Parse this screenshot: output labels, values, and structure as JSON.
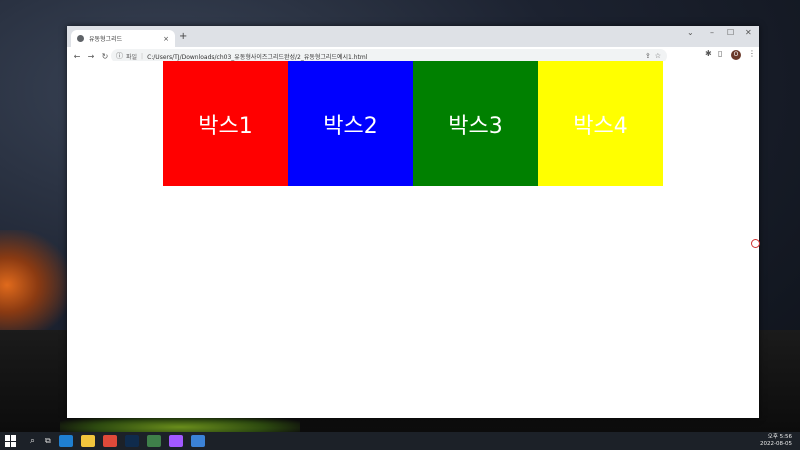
{
  "browser": {
    "tab_title": "유동형그리드",
    "tab_close": "×",
    "new_tab": "+",
    "window_controls": {
      "minimize": "–",
      "maximize": "☐",
      "close": "✕",
      "tab_search": "⌄"
    },
    "nav": {
      "back": "←",
      "forward": "→",
      "reload": "↻"
    },
    "address": {
      "info_icon": "ⓘ",
      "scheme_label": "파일",
      "separator": "|",
      "url": "C:/Users/TJ/Downloads/ch03_유동형사이즈그리드완성/2_유동형그리드예시1.html"
    },
    "omnibox_icons": {
      "share": "⇪",
      "star": "☆"
    },
    "toolbar_icons": {
      "extensions": "✱",
      "sidepanel": "▯",
      "menu": "⋮"
    },
    "profile_initial": "O"
  },
  "page": {
    "boxes": [
      {
        "label": "박스1",
        "color": "#ff0000"
      },
      {
        "label": "박스2",
        "color": "#0000ff"
      },
      {
        "label": "박스3",
        "color": "#008000"
      },
      {
        "label": "박스4",
        "color": "#ffff00"
      }
    ]
  },
  "taskbar": {
    "search_icon": "⌕",
    "taskview_icon": "⧉",
    "apps": [
      {
        "name": "edge-icon",
        "color": "#1f7fd1"
      },
      {
        "name": "file-explorer-icon",
        "color": "#f2c53d"
      },
      {
        "name": "chrome-icon",
        "color": "#e04a3a"
      },
      {
        "name": "photoshop-icon",
        "color": "#0f2b4c"
      },
      {
        "name": "app-icon",
        "color": "#3f7f4a"
      },
      {
        "name": "figma-icon",
        "color": "#a259ff"
      },
      {
        "name": "chrome-active-icon",
        "color": "#3b82d6"
      }
    ],
    "clock": {
      "time": "오후 5:56",
      "date": "2022-08-05"
    }
  }
}
